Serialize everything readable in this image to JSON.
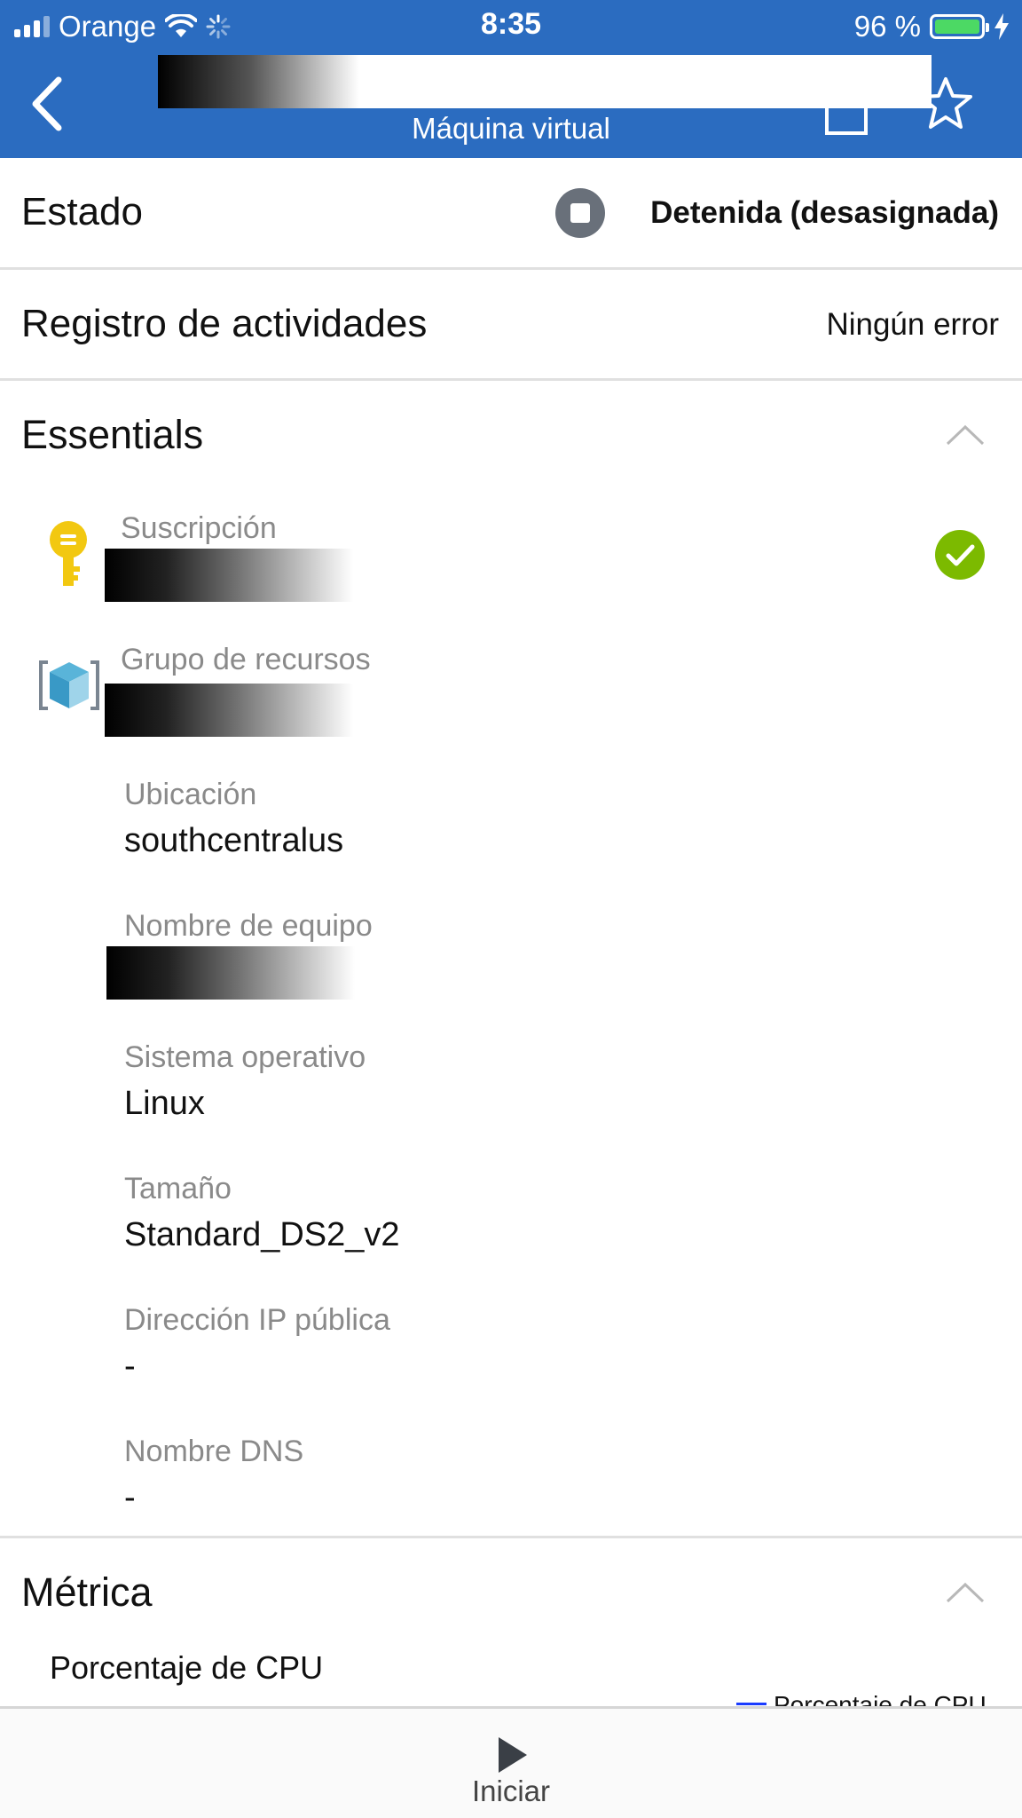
{
  "status_bar": {
    "carrier": "Orange",
    "time": "8:35",
    "battery": "96 %",
    "battery_level": 0.96
  },
  "nav": {
    "subtitle": "Máquina virtual"
  },
  "estado": {
    "label": "Estado",
    "value": "Detenida (desasignada)"
  },
  "registro": {
    "label": "Registro de actividades",
    "value": "Ningún error"
  },
  "essentials": {
    "title": "Essentials",
    "suscripcion_label": "Suscripción",
    "grupo_label": "Grupo de recursos",
    "ubicacion_label": "Ubicación",
    "ubicacion_value": "southcentralus",
    "nombre_equipo_label": "Nombre de equipo",
    "so_label": "Sistema operativo",
    "so_value": "Linux",
    "tamano_label": "Tamaño",
    "tamano_value": "Standard_DS2_v2",
    "ip_label": "Dirección IP pública",
    "ip_value": "-",
    "dns_label": "Nombre DNS",
    "dns_value": "-"
  },
  "metrica": {
    "title": "Métrica",
    "subtitle": "Porcentaje de CPU",
    "legend": "Porcentaje de CPU"
  },
  "toolbar": {
    "start_label": "Iniciar"
  },
  "colors": {
    "header": "#2b6cc0",
    "status_stopped": "#69707a",
    "check_green": "#7cba00",
    "key_gold": "#f2c811"
  }
}
